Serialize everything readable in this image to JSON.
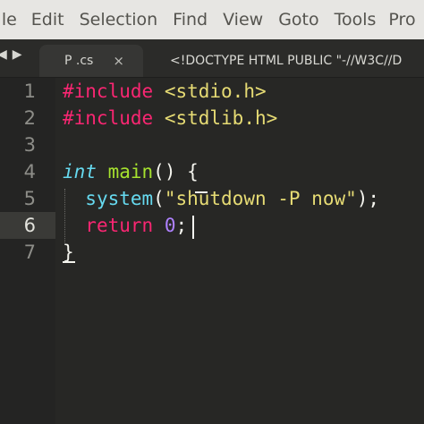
{
  "menubar": {
    "items": [
      "File",
      "Edit",
      "Selection",
      "Find",
      "View",
      "Goto",
      "Tools",
      "Pro"
    ]
  },
  "tabbar": {
    "arrow_left": "◀",
    "arrow_right": "▶",
    "tabs": [
      {
        "label": "P .cs",
        "close": "×",
        "active": true
      },
      {
        "label": "<!DOCTYPE HTML PUBLIC \"-//W3C//D",
        "active": false
      }
    ]
  },
  "editor": {
    "line_numbers": [
      "1",
      "2",
      "3",
      "4",
      "5",
      "6",
      "7"
    ],
    "current_line": 6,
    "lines": [
      [
        {
          "text": "#include",
          "cls": "kw-pink"
        },
        {
          "text": " ",
          "cls": "plain"
        },
        {
          "text": "<stdio.h>",
          "cls": "str-yellow"
        }
      ],
      [
        {
          "text": "#include",
          "cls": "kw-pink"
        },
        {
          "text": " ",
          "cls": "plain"
        },
        {
          "text": "<stdlib.h>",
          "cls": "str-yellow"
        }
      ],
      [],
      [
        {
          "text": "int",
          "cls": "kw-type"
        },
        {
          "text": " ",
          "cls": "plain"
        },
        {
          "text": "main",
          "cls": "fn-green"
        },
        {
          "text": "() {",
          "cls": "plain"
        }
      ],
      [
        {
          "text": "  ",
          "cls": "plain"
        },
        {
          "text": "system",
          "cls": "fn-blue"
        },
        {
          "text": "(",
          "cls": "plain"
        },
        {
          "text": "\"shutdown -P now\"",
          "cls": "str-yellow"
        },
        {
          "text": ");",
          "cls": "plain"
        }
      ],
      [
        {
          "text": "  ",
          "cls": "plain"
        },
        {
          "text": "return",
          "cls": "kw-pink"
        },
        {
          "text": " ",
          "cls": "plain"
        },
        {
          "text": "0",
          "cls": "num-purple"
        },
        {
          "text": ";",
          "cls": "plain"
        }
      ],
      [
        {
          "text": "}",
          "cls": "plain"
        }
      ]
    ]
  },
  "colors": {
    "keyword": "#f92672",
    "type": "#66d9ef",
    "function": "#a6e22e",
    "string": "#e6db74",
    "number": "#ae81ff",
    "background": "#272725"
  }
}
